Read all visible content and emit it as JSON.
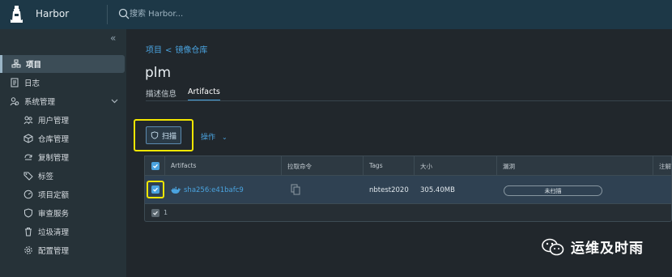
{
  "header": {
    "brand": "Harbor",
    "search_placeholder": "搜索 Harbor..."
  },
  "sidebar": {
    "collapse_glyph": "«",
    "items": [
      {
        "label": "项目",
        "icon": "project-icon"
      },
      {
        "label": "日志",
        "icon": "log-icon"
      },
      {
        "label": "系统管理",
        "icon": "admin-icon"
      },
      {
        "label": "用户管理",
        "icon": "users-icon"
      },
      {
        "label": "仓库管理",
        "icon": "registry-icon"
      },
      {
        "label": "复制管理",
        "icon": "replication-icon"
      },
      {
        "label": "标签",
        "icon": "tag-icon"
      },
      {
        "label": "项目定额",
        "icon": "quota-icon"
      },
      {
        "label": "审查服务",
        "icon": "shield-icon"
      },
      {
        "label": "垃圾清理",
        "icon": "trash-icon"
      },
      {
        "label": "配置管理",
        "icon": "gear-icon"
      }
    ]
  },
  "breadcrumb": {
    "project": "项目",
    "sep": "<",
    "repo": "镜像仓库"
  },
  "page": {
    "title": "plm"
  },
  "tabs": [
    {
      "label": "描述信息"
    },
    {
      "label": "Artifacts"
    }
  ],
  "toolbar": {
    "scan_label": "扫描",
    "ops_label": "操作",
    "ops_chevron": "⌄"
  },
  "table": {
    "headers": [
      "Artifacts",
      "拉取命令",
      "Tags",
      "大小",
      "漏洞",
      "注解"
    ],
    "rows": [
      {
        "artifact": "sha256:e41bafc9",
        "tags": "nbtest2020",
        "size": "305.40MB",
        "vuln": "未扫描"
      }
    ],
    "footer_count": "1"
  },
  "watermark": {
    "text": "运维及时雨"
  },
  "colors": {
    "accent": "#4aa3df",
    "highlight": "#f2e600",
    "topbar": "#1d3847"
  }
}
